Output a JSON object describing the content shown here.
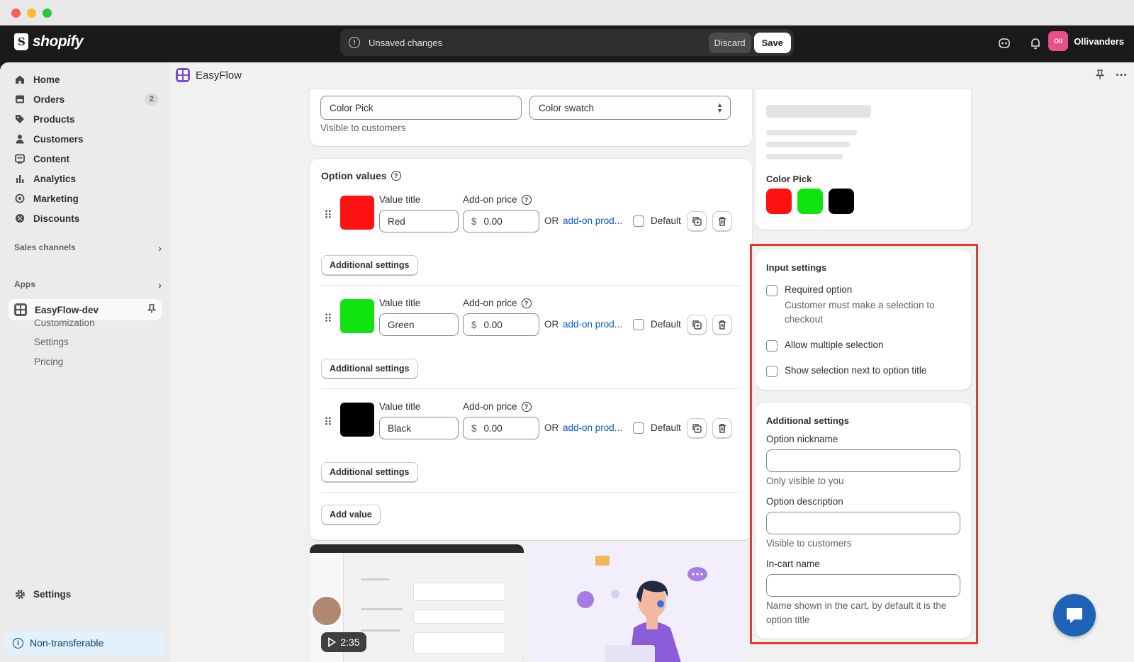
{
  "window": {
    "controls": [
      "close",
      "minimize",
      "zoom"
    ]
  },
  "topbar": {
    "brand": "shopify",
    "status_text": "Unsaved changes",
    "discard_label": "Discard",
    "save_label": "Save",
    "store_initials": "Oll",
    "store_name": "Ollivanders"
  },
  "sidebar": {
    "items": [
      {
        "label": "Home",
        "icon": "home-icon"
      },
      {
        "label": "Orders",
        "icon": "orders-icon",
        "badge": "2"
      },
      {
        "label": "Products",
        "icon": "tag-icon"
      },
      {
        "label": "Customers",
        "icon": "person-icon"
      },
      {
        "label": "Content",
        "icon": "content-icon"
      },
      {
        "label": "Analytics",
        "icon": "bar-chart-icon"
      },
      {
        "label": "Marketing",
        "icon": "target-icon"
      },
      {
        "label": "Discounts",
        "icon": "discount-icon"
      }
    ],
    "sales_channels": "Sales channels",
    "apps": "Apps",
    "active_app": "EasyFlow-dev",
    "sub_items": [
      "Customization",
      "Settings",
      "Pricing"
    ],
    "settings": "Settings",
    "non_transferable": "Non-transferable"
  },
  "app_header": {
    "title": "EasyFlow"
  },
  "option_card": {
    "name_value": "Color Pick",
    "type_value": "Color swatch",
    "help": "Visible to customers"
  },
  "option_values": {
    "title": "Option values",
    "value_title_label": "Value title",
    "addon_price_label": "Add-on price",
    "or_text": "OR",
    "addon_link": "add-on prod...",
    "default_label": "Default",
    "additional_settings": "Additional settings",
    "currency": "$",
    "add_value": "Add value",
    "rows": [
      {
        "title": "Red",
        "price": "0.00",
        "color": "#ff1111"
      },
      {
        "title": "Green",
        "price": "0.00",
        "color": "#11e311"
      },
      {
        "title": "Black",
        "price": "0.00",
        "color": "#000000"
      }
    ]
  },
  "video": {
    "duration": "2:35"
  },
  "preview": {
    "label": "Color Pick",
    "swatches": [
      "#ff1111",
      "#11e311",
      "#000000"
    ]
  },
  "input_settings": {
    "title": "Input settings",
    "required": "Required option",
    "required_help": "Customer must make a selection to checkout",
    "multiple": "Allow multiple selection",
    "show_selection": "Show selection next to option title"
  },
  "additional_settings": {
    "title": "Additional settings",
    "nickname_label": "Option nickname",
    "nickname_help": "Only visible to you",
    "description_label": "Option description",
    "description_help": "Visible to customers",
    "incart_label": "In-cart name",
    "incart_help": "Name shown in the cart, by default it is the option title"
  },
  "colors": {
    "accent_link": "#005bd3",
    "highlight": "#e53935",
    "chat": "#1e63b8"
  }
}
